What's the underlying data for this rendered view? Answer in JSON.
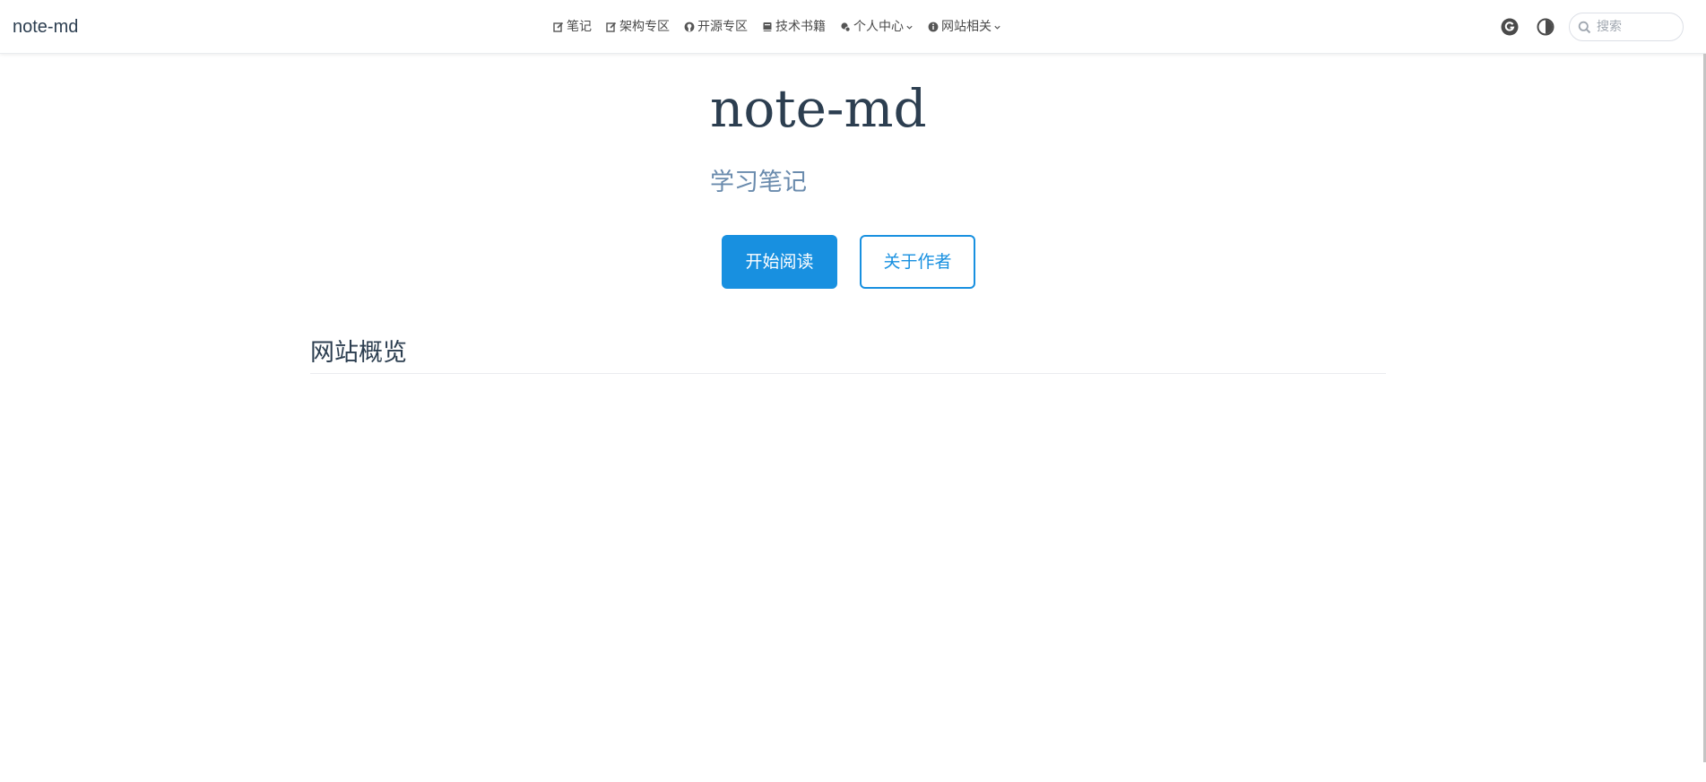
{
  "navbar": {
    "site_name": "note-md",
    "links": [
      {
        "label": "笔记",
        "icon": "edit-icon"
      },
      {
        "label": "架构专区",
        "icon": "edit-icon"
      },
      {
        "label": "开源专区",
        "icon": "github-icon"
      },
      {
        "label": "技术书籍",
        "icon": "book-icon"
      },
      {
        "label": "个人中心",
        "icon": "user-gear-icon",
        "dropdown": true
      },
      {
        "label": "网站相关",
        "icon": "info-icon",
        "dropdown": true
      }
    ],
    "tools": {
      "language_icon": "language-icon",
      "theme_icon": "contrast-icon"
    },
    "search": {
      "placeholder": "搜索",
      "value": ""
    }
  },
  "hero": {
    "title": "note-md",
    "description": "学习笔记",
    "primary_action": "开始阅读",
    "secondary_action": "关于作者"
  },
  "overview": {
    "heading": "网站概览"
  },
  "colors": {
    "accent": "#1890e0",
    "text": "#2c3e50",
    "description": "#6a8bad",
    "nav_text": "#4a4a4a"
  }
}
